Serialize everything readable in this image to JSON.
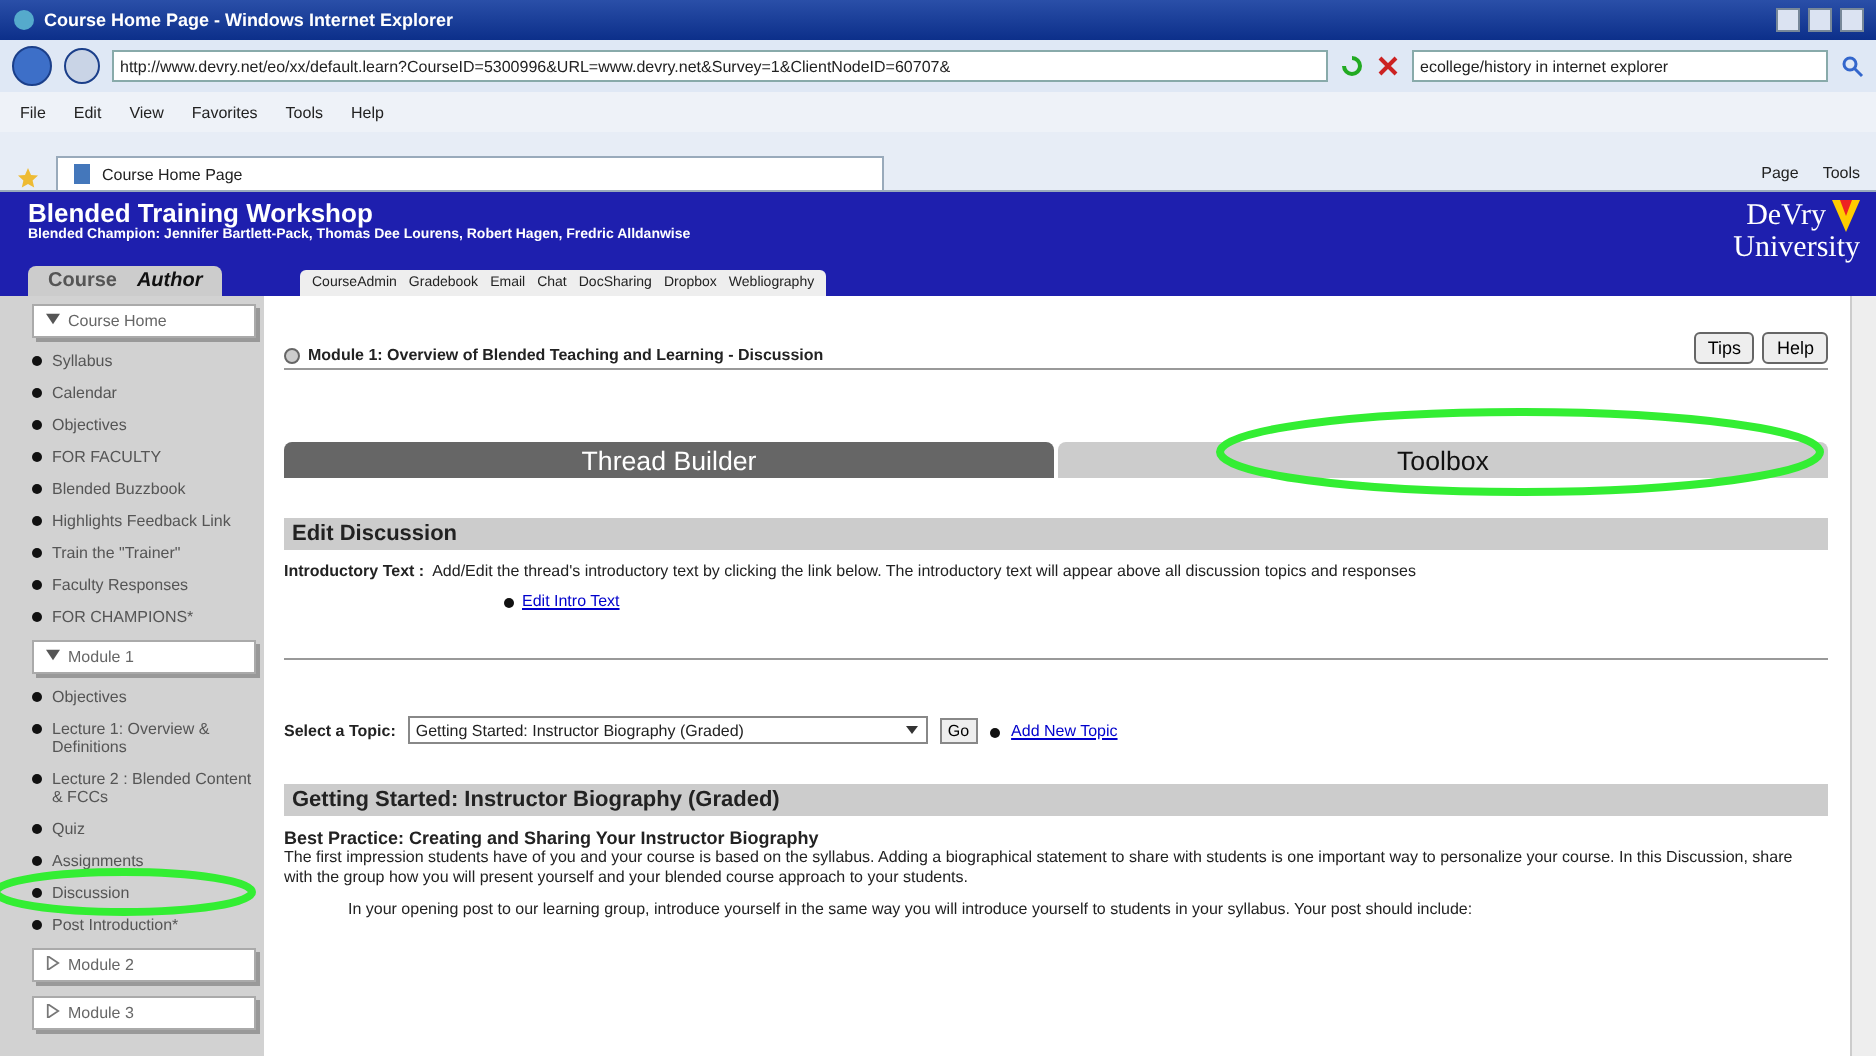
{
  "window": {
    "title": "Course Home Page - Windows Internet Explorer"
  },
  "address_bar": {
    "url": "http://www.devry.net/eo/xx/default.learn?CourseID=5300996&URL=www.devry.net&Survey=1&ClientNodeID=60707&",
    "search": "ecollege/history in internet explorer"
  },
  "menu": [
    "File",
    "Edit",
    "View",
    "Favorites",
    "Tools",
    "Help"
  ],
  "browser_tab": {
    "title": "Course Home Page"
  },
  "command_bar": [
    "Page",
    "Tools"
  ],
  "header": {
    "title": "Blended Training Workshop",
    "subtitle": "Blended Champion: Jennifer Bartlett-Pack, Thomas Dee Lourens, Robert Hagen, Fredric Alldanwise",
    "logo_line_1": "DeVry",
    "logo_line_2": "University"
  },
  "mode_tabs": [
    {
      "label": "Course",
      "selected": false
    },
    {
      "label": "Author",
      "selected": true
    }
  ],
  "course_links": [
    "CourseAdmin",
    "Gradebook",
    "Email",
    "Chat",
    "DocSharing",
    "Dropbox",
    "Webliography"
  ],
  "sidebar": [
    {
      "kind": "header",
      "label": "Course Home",
      "expanded": true
    },
    {
      "kind": "item",
      "label": "Syllabus"
    },
    {
      "kind": "item",
      "label": "Calendar"
    },
    {
      "kind": "item",
      "label": "Objectives"
    },
    {
      "kind": "item",
      "label": "FOR FACULTY"
    },
    {
      "kind": "item",
      "label": "Blended Buzzbook"
    },
    {
      "kind": "item",
      "label": "Highlights Feedback Link"
    },
    {
      "kind": "item",
      "label": "Train the \"Trainer\""
    },
    {
      "kind": "item",
      "label": "Faculty Responses"
    },
    {
      "kind": "item",
      "label": "FOR CHAMPIONS*"
    },
    {
      "kind": "header",
      "label": "Module 1",
      "expanded": true
    },
    {
      "kind": "item",
      "label": "Objectives"
    },
    {
      "kind": "item",
      "label": "Lecture 1: Overview & Definitions"
    },
    {
      "kind": "item",
      "label": "Lecture 2 : Blended Content & FCCs"
    },
    {
      "kind": "item",
      "label": "Quiz"
    },
    {
      "kind": "item",
      "label": "Assignments"
    },
    {
      "kind": "item",
      "label": "Discussion"
    },
    {
      "kind": "item",
      "label": "Post Introduction*"
    },
    {
      "kind": "header",
      "label": "Module 2",
      "expanded": false
    },
    {
      "kind": "header",
      "label": "Module 3",
      "expanded": false
    }
  ],
  "page": {
    "title": "Module 1: Overview of Blended Teaching and Learning - Discussion",
    "buttons": [
      "Tips",
      "Help"
    ]
  },
  "builder_tabs": [
    {
      "label": "Thread Builder",
      "selected": true
    },
    {
      "label": "Toolbox",
      "selected": false
    }
  ],
  "edit_section": {
    "heading": "Edit Discussion",
    "label": "Introductory Text :",
    "text": "Add/Edit the thread's introductory text by clicking the link below. The introductory text will appear above all discussion topics and responses",
    "link": "Edit Intro Text"
  },
  "topic_select": {
    "label": "Select a Topic:",
    "value": "Getting Started: Instructor Biography (Graded)",
    "go": "Go",
    "add_link": "Add New Topic"
  },
  "topic": {
    "heading": "Getting Started: Instructor Biography (Graded)",
    "subheading": "Best Practice: Creating and Sharing Your Instructor Biography",
    "paragraph": "The first impression students have of you and your course is based on the syllabus. Adding a biographical statement to share with students is one important way to personalize your course. In this Discussion, share with the group how you will present yourself and your blended course approach to your students.",
    "indented": "In your opening post to our learning group, introduce yourself in the same way you will introduce yourself to students in your syllabus. Your post should include:"
  }
}
